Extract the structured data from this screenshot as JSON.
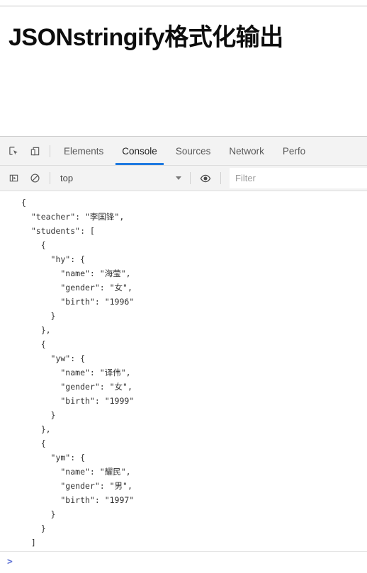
{
  "theme": {
    "accent": "#1f7ae0",
    "devtools_bg": "#f3f3f3",
    "console_bg": "#ffffff",
    "text": "#303030",
    "prompt_color": "#6275d6"
  },
  "page": {
    "title": "JSONstringify格式化输出"
  },
  "devtools": {
    "toolbar_icons": [
      {
        "name": "inspect-element-icon",
        "title": "Inspect element"
      },
      {
        "name": "device-toolbar-icon",
        "title": "Toggle device toolbar"
      }
    ],
    "tabs": [
      {
        "label": "Elements",
        "active": false
      },
      {
        "label": "Console",
        "active": true
      },
      {
        "label": "Sources",
        "active": false
      },
      {
        "label": "Network",
        "active": false
      },
      {
        "label": "Perfo",
        "active": false
      }
    ],
    "console_toolbar": {
      "sidebar_toggle_icon": "console-sidebar-icon",
      "clear_console_icon": "clear-console-icon",
      "context": "top",
      "context_options": [
        "top"
      ],
      "live_expression_icon": "eye-icon",
      "filter_placeholder": "Filter",
      "filter_value": ""
    },
    "prompt": {
      "caret": ">",
      "value": "",
      "placeholder": ""
    }
  },
  "console_log": {
    "text": "{\n  \"teacher\": \"李国锋\",\n  \"students\": [\n    {\n      \"hy\": {\n        \"name\": \"海莹\",\n        \"gender\": \"女\",\n        \"birth\": \"1996\"\n      }\n    },\n    {\n      \"yw\": {\n        \"name\": \"译伟\",\n        \"gender\": \"女\",\n        \"birth\": \"1999\"\n      }\n    },\n    {\n      \"ym\": {\n        \"name\": \"耀民\",\n        \"gender\": \"男\",\n        \"birth\": \"1997\"\n      }\n    }\n  ]\n}",
    "object": {
      "teacher": "李国锋",
      "students": [
        {
          "hy": {
            "name": "海莹",
            "gender": "女",
            "birth": "1996"
          }
        },
        {
          "yw": {
            "name": "译伟",
            "gender": "女",
            "birth": "1999"
          }
        },
        {
          "ym": {
            "name": "耀民",
            "gender": "男",
            "birth": "1997"
          }
        }
      ]
    }
  }
}
